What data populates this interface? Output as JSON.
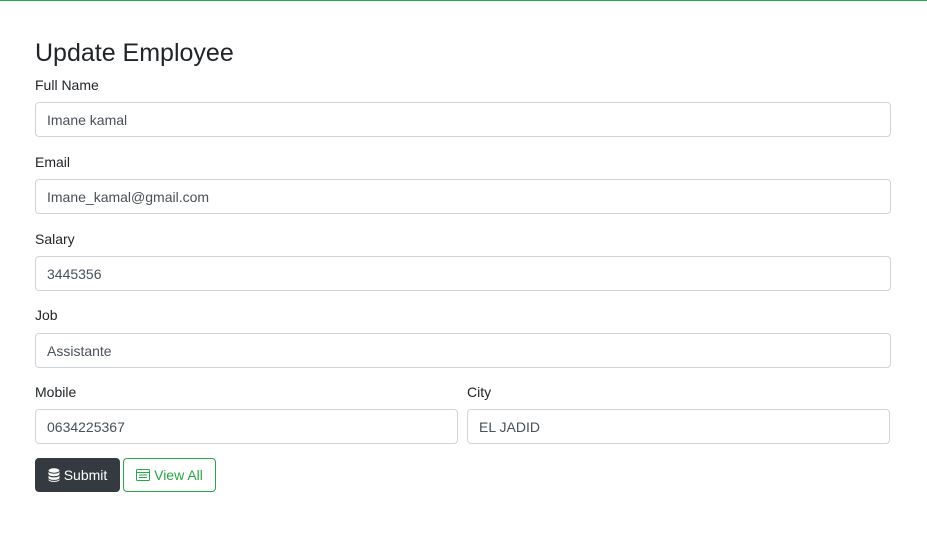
{
  "page": {
    "title": "Update Employee"
  },
  "form": {
    "full_name": {
      "label": "Full Name",
      "value": "Imane kamal"
    },
    "email": {
      "label": "Email",
      "value": "Imane_kamal@gmail.com"
    },
    "salary": {
      "label": "Salary",
      "value": "3445356"
    },
    "job": {
      "label": "Job",
      "value": "Assistante"
    },
    "mobile": {
      "label": "Mobile",
      "value": "0634225367"
    },
    "city": {
      "label": "City",
      "value": "EL JADID"
    }
  },
  "buttons": {
    "submit_label": "Submit",
    "submit_icon": "database-icon",
    "view_all_label": "View All",
    "view_all_icon": "table-list-icon"
  },
  "colors": {
    "accent_green": "#28a745",
    "dark_button": "#343a40",
    "input_border": "#ced4da"
  }
}
